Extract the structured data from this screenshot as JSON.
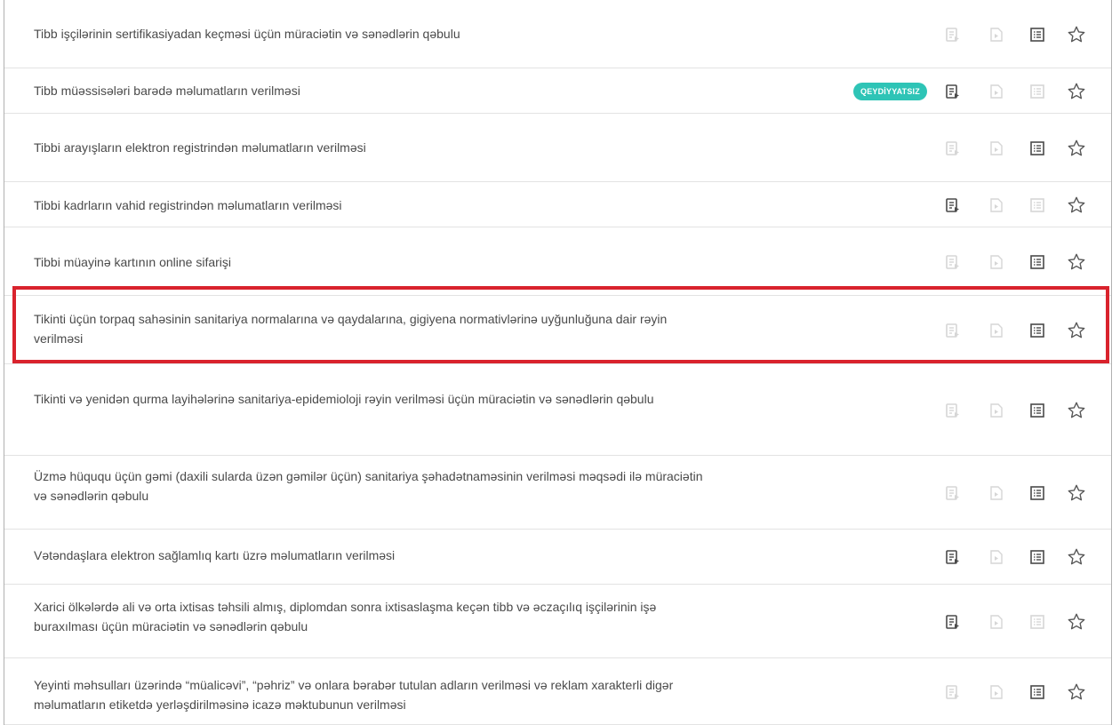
{
  "services": [
    {
      "text": "Tibb işçilərinin sertifikasiyadan keçməsi üçün müraciətin və sənədlərin qəbulu",
      "badge": null,
      "electronic": false,
      "video": false,
      "info": true
    },
    {
      "text": "Tibb müəssisələri barədə məlumatların verilməsi",
      "badge": "QEYDİYYATSIZ",
      "electronic": true,
      "video": false,
      "info": false
    },
    {
      "text": "Tibbi arayışların elektron registrindən məlumatların verilməsi",
      "badge": null,
      "electronic": false,
      "video": false,
      "info": true
    },
    {
      "text": "Tibbi kadrların vahid registrindən məlumatların verilməsi",
      "badge": null,
      "electronic": true,
      "video": false,
      "info": false
    },
    {
      "text": "Tibbi müayinə kartının online sifarişi",
      "badge": null,
      "electronic": false,
      "video": false,
      "info": true
    },
    {
      "text": "Tikinti üçün torpaq sahəsinin sanitariya normalarına və qaydalarına, gigiyena normativlərinə uyğunluğuna dair rəyin verilməsi",
      "badge": null,
      "electronic": false,
      "video": false,
      "info": true,
      "highlighted": true
    },
    {
      "text": "Tikinti və yenidən qurma layihələrinə sanitariya-epidemioloji rəyin verilməsi üçün müraciətin və sənədlərin qəbulu",
      "badge": null,
      "electronic": false,
      "video": false,
      "info": true
    },
    {
      "text": "Üzmə hüququ üçün gəmi (daxili sularda üzən gəmilər üçün) sanitariya şəhadətnaməsinin verilməsi məqsədi ilə müraciətin və sənədlərin qəbulu",
      "badge": null,
      "electronic": false,
      "video": false,
      "info": true
    },
    {
      "text": "Vətəndaşlara elektron sağlamlıq kartı üzrə məlumatların verilməsi",
      "badge": null,
      "electronic": true,
      "video": false,
      "info": true
    },
    {
      "text": "Xarici ölkələrdə ali və orta ixtisas təhsili almış, diplomdan sonra ixtisaslaşma keçən tibb və əczaçılıq işçilərinin işə buraxılması üçün müraciətin və sənədlərin qəbulu",
      "badge": null,
      "electronic": true,
      "video": false,
      "info": false
    },
    {
      "text": "Yeyinti məhsulları üzərində “müalicəvi”, “pəhriz” və onlara bərabər tutulan adların verilməsi və reklam xarakterli digər məlumatların etiketdə yerləşdirilməsinə icazə məktubunun verilməsi",
      "badge": null,
      "electronic": false,
      "video": false,
      "info": true
    }
  ],
  "colors": {
    "icon_active": "#4a4a4a",
    "icon_inactive": "#d6d6d6",
    "badge": "#2ec4b6",
    "highlight": "#d9232d"
  },
  "icons": [
    "electronic-service-icon",
    "video-file-icon",
    "info-list-icon",
    "favorite-star-icon"
  ]
}
